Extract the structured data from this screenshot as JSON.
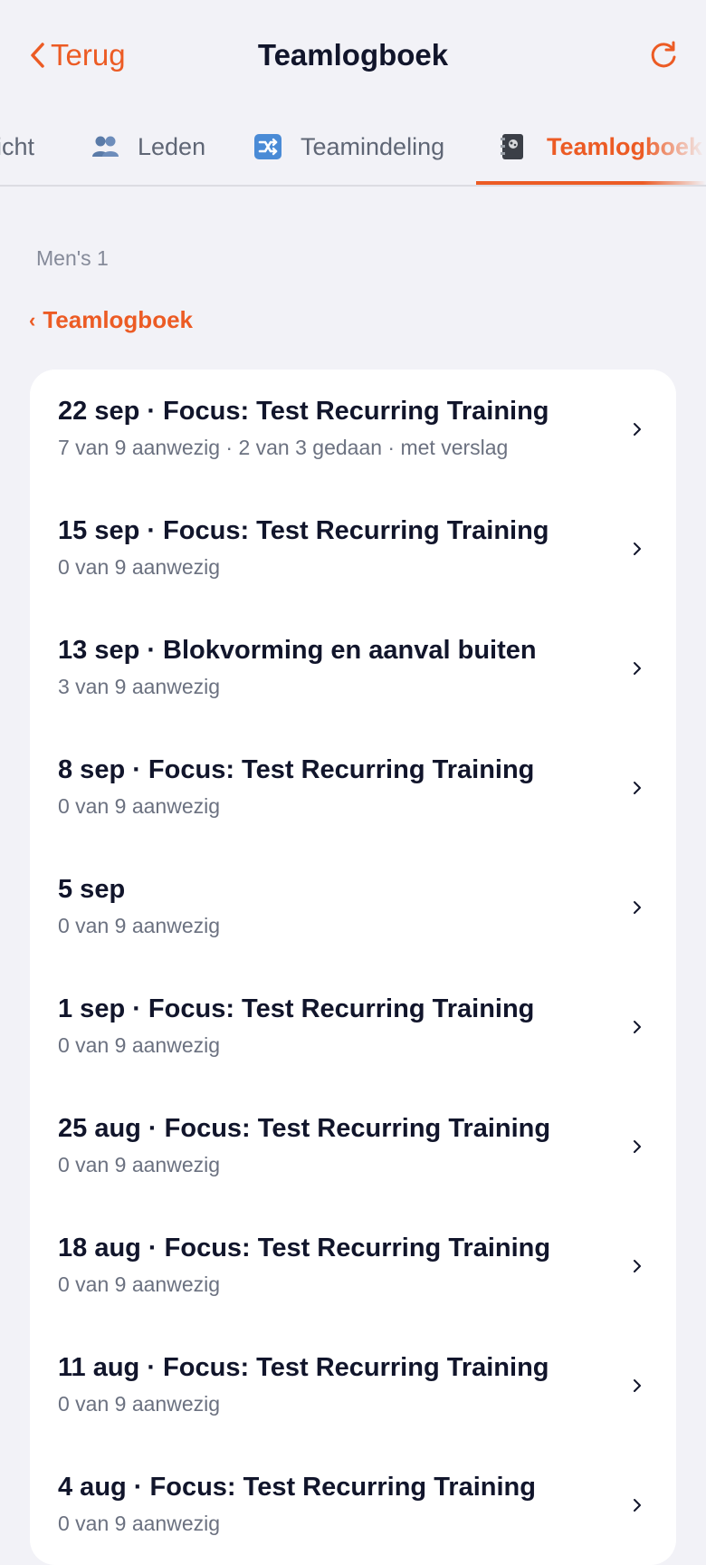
{
  "nav": {
    "back_label": "Terug",
    "title": "Teamlogboek"
  },
  "tabs": [
    {
      "label": "icht",
      "icon": "overview-icon",
      "active": false
    },
    {
      "label": "Leden",
      "icon": "people-icon",
      "active": false
    },
    {
      "label": "Teamindeling",
      "icon": "shuffle-icon",
      "active": false
    },
    {
      "label": "Teamlogboek",
      "icon": "notebook-icon",
      "active": true
    }
  ],
  "section_label": "Men's 1",
  "breadcrumb": {
    "chevron": "‹",
    "label": "Teamlogboek"
  },
  "entries": [
    {
      "title": "22 sep · Focus: Test Recurring Training",
      "subtitle": "7 van 9 aanwezig · 2 van 3 gedaan · met verslag"
    },
    {
      "title": "15 sep · Focus: Test Recurring Training",
      "subtitle": "0 van 9 aanwezig"
    },
    {
      "title": "13 sep · Blokvorming en aanval buiten",
      "subtitle": "3 van 9 aanwezig"
    },
    {
      "title": "8 sep · Focus: Test Recurring Training",
      "subtitle": "0 van 9 aanwezig"
    },
    {
      "title": "5 sep",
      "subtitle": "0 van 9 aanwezig"
    },
    {
      "title": "1 sep · Focus: Test Recurring Training",
      "subtitle": "0 van 9 aanwezig"
    },
    {
      "title": "25 aug · Focus: Test Recurring Training",
      "subtitle": "0 van 9 aanwezig"
    },
    {
      "title": "18 aug · Focus: Test Recurring Training",
      "subtitle": "0 van 9 aanwezig"
    },
    {
      "title": "11 aug · Focus: Test Recurring Training",
      "subtitle": "0 van 9 aanwezig"
    },
    {
      "title": "4 aug · Focus: Test Recurring Training",
      "subtitle": "0 van 9 aanwezig"
    }
  ],
  "colors": {
    "accent": "#ec5b24",
    "background": "#f2f2f7",
    "card": "#ffffff",
    "text_primary": "#11152b",
    "text_secondary": "#6b7180"
  }
}
